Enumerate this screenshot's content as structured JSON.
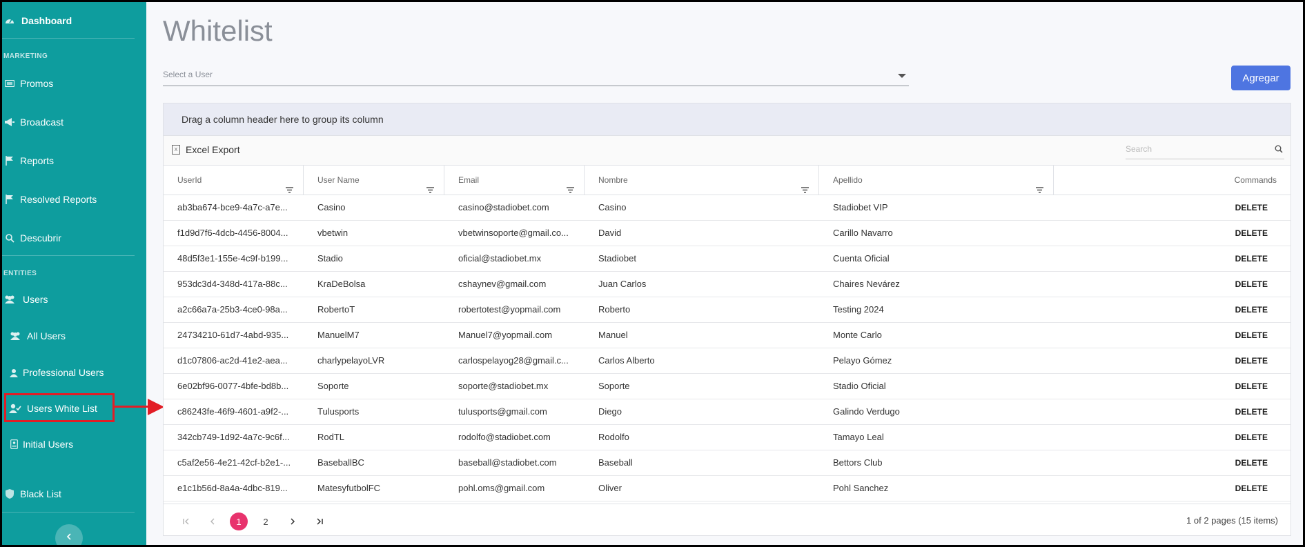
{
  "sidebar": {
    "dashboard": "Dashboard",
    "section_marketing": "MARKETING",
    "promos": "Promos",
    "broadcast": "Broadcast",
    "reports": "Reports",
    "resolved_reports": "Resolved Reports",
    "descubrir": "Descubrir",
    "section_entities": "ENTITIES",
    "users": "Users",
    "all_users": "All Users",
    "professional_users": "Professional Users",
    "users_white_list": "Users White List",
    "initial_users": "Initial Users",
    "black_list": "Black List"
  },
  "page": {
    "title": "Whitelist",
    "select_placeholder": "Select a User",
    "add_button": "Agregar"
  },
  "grid": {
    "group_panel_text": "Drag a column header here to group its column",
    "excel_export": "Excel Export",
    "search_placeholder": "Search",
    "columns": [
      "UserId",
      "User Name",
      "Email",
      "Nombre",
      "Apellido",
      "Commands"
    ],
    "rows": [
      {
        "id": "ab3ba674-bce9-4a7c-a7e...",
        "username": "Casino",
        "email": "casino@stadiobet.com",
        "nombre": "Casino",
        "apellido": "Stadiobet VIP",
        "cmd": "DELETE"
      },
      {
        "id": "f1d9d7f6-4dcb-4456-8004...",
        "username": "vbetwin",
        "email": "vbetwinsoporte@gmail.co...",
        "nombre": "David",
        "apellido": "Carillo Navarro",
        "cmd": "DELETE"
      },
      {
        "id": "48d5f3e1-155e-4c9f-b199...",
        "username": "Stadio",
        "email": "oficial@stadiobet.mx",
        "nombre": "Stadiobet",
        "apellido": "Cuenta Oficial",
        "cmd": "DELETE"
      },
      {
        "id": "953dc3d4-348d-417a-88c...",
        "username": "KraDeBolsa",
        "email": "cshaynev@gmail.com",
        "nombre": "Juan Carlos",
        "apellido": "Chaires Nevárez",
        "cmd": "DELETE"
      },
      {
        "id": "a2c66a7a-25b3-4ce0-98a...",
        "username": "RobertoT",
        "email": "robertotest@yopmail.com",
        "nombre": "Roberto",
        "apellido": "Testing 2024",
        "cmd": "DELETE"
      },
      {
        "id": "24734210-61d7-4abd-935...",
        "username": "ManuelM7",
        "email": "Manuel7@yopmail.com",
        "nombre": "Manuel",
        "apellido": "Monte Carlo",
        "cmd": "DELETE"
      },
      {
        "id": "d1c07806-ac2d-41e2-aea...",
        "username": "charlypelayoLVR",
        "email": "carlospelayog28@gmail.c...",
        "nombre": "Carlos Alberto",
        "apellido": "Pelayo Gómez",
        "cmd": "DELETE"
      },
      {
        "id": "6e02bf96-0077-4bfe-bd8b...",
        "username": "Soporte",
        "email": "soporte@stadiobet.mx",
        "nombre": "Soporte",
        "apellido": "Stadio Oficial",
        "cmd": "DELETE"
      },
      {
        "id": "c86243fe-46f9-4601-a9f2-...",
        "username": "Tulusports",
        "email": "tulusports@gmail.com",
        "nombre": "Diego",
        "apellido": "Galindo Verdugo",
        "cmd": "DELETE"
      },
      {
        "id": "342cb749-1d92-4a7c-9c6f...",
        "username": "RodTL",
        "email": "rodolfo@stadiobet.com",
        "nombre": "Rodolfo",
        "apellido": "Tamayo Leal",
        "cmd": "DELETE"
      },
      {
        "id": "c5af2e56-4e21-42cf-b2e1-...",
        "username": "BaseballBC",
        "email": "baseball@stadiobet.com",
        "nombre": "Baseball",
        "apellido": "Bettors Club",
        "cmd": "DELETE"
      },
      {
        "id": "e1c1b56d-8a4a-4dbc-819...",
        "username": "MatesyfutbolFC",
        "email": "pohl.oms@gmail.com",
        "nombre": "Oliver",
        "apellido": "Pohl Sanchez",
        "cmd": "DELETE"
      }
    ],
    "pager": {
      "page1": "1",
      "page2": "2",
      "info": "1 of 2 pages (15 items)"
    }
  },
  "colors": {
    "sidebar_bg": "#0e9d9e",
    "accent_button": "#4e75e1",
    "current_page": "#e8336d",
    "annotation_red": "#e21d25"
  },
  "icons": {
    "dashboard": "speedometer-icon",
    "promos": "ticket-icon",
    "broadcast": "megaphone-icon",
    "reports": "flag-icon",
    "resolved_reports": "flag-icon",
    "descubrir": "search-icon",
    "users": "users-icon",
    "all_users": "users-icon",
    "professional_users": "user-icon",
    "users_white_list": "user-check-icon",
    "initial_users": "id-card-icon",
    "black_list": "shield-icon"
  }
}
